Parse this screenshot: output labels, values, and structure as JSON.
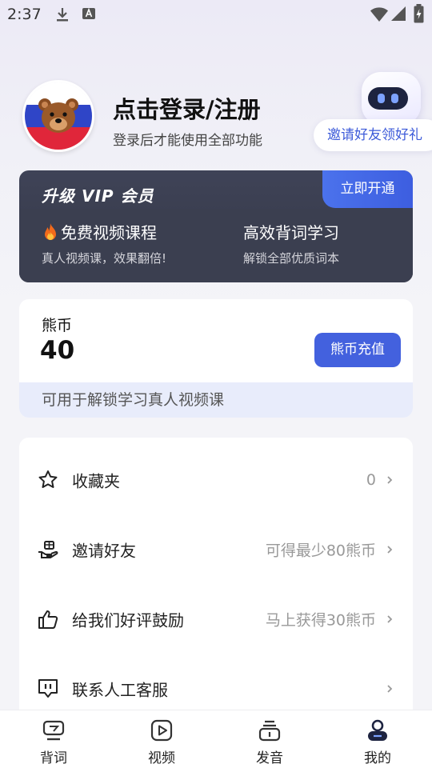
{
  "status_bar": {
    "time": "2:37"
  },
  "profile": {
    "title": "点击登录/注册",
    "subtitle": "登录后才能使用全部功能",
    "invite_pill": "邀请好友领好礼"
  },
  "vip": {
    "title": "升级 VIP 会员",
    "open_button": "立即开通",
    "features": [
      {
        "title": "免费视频课程",
        "desc": "真人视频课，效果翻倍!"
      },
      {
        "title": "高效背词学习",
        "desc": "解锁全部优质词本"
      }
    ]
  },
  "coins": {
    "label": "熊币",
    "value": "40",
    "recharge_button": "熊币充值",
    "note": "可用于解锁学习真人视频课"
  },
  "menu": {
    "items": [
      {
        "label": "收藏夹",
        "value": "0",
        "icon": "star-icon"
      },
      {
        "label": "邀请好友",
        "value": "可得最少80熊币",
        "icon": "hand-gift-icon"
      },
      {
        "label": "给我们好评鼓励",
        "value": "马上获得30熊币",
        "icon": "thumbs-up-icon"
      },
      {
        "label": "联系人工客服",
        "value": "",
        "icon": "chat-bubble-icon"
      }
    ]
  },
  "bottom_nav": {
    "items": [
      {
        "label": "背词",
        "icon": "vocabulary-icon"
      },
      {
        "label": "视频",
        "icon": "video-play-icon"
      },
      {
        "label": "发音",
        "icon": "pronunciation-icon"
      },
      {
        "label": "我的",
        "icon": "profile-icon"
      }
    ]
  },
  "colors": {
    "accent": "#4361de",
    "vip_card": "#3b3f50",
    "invite_text": "#3d5bd9",
    "coin_note_bg": "#e8ecfb"
  }
}
